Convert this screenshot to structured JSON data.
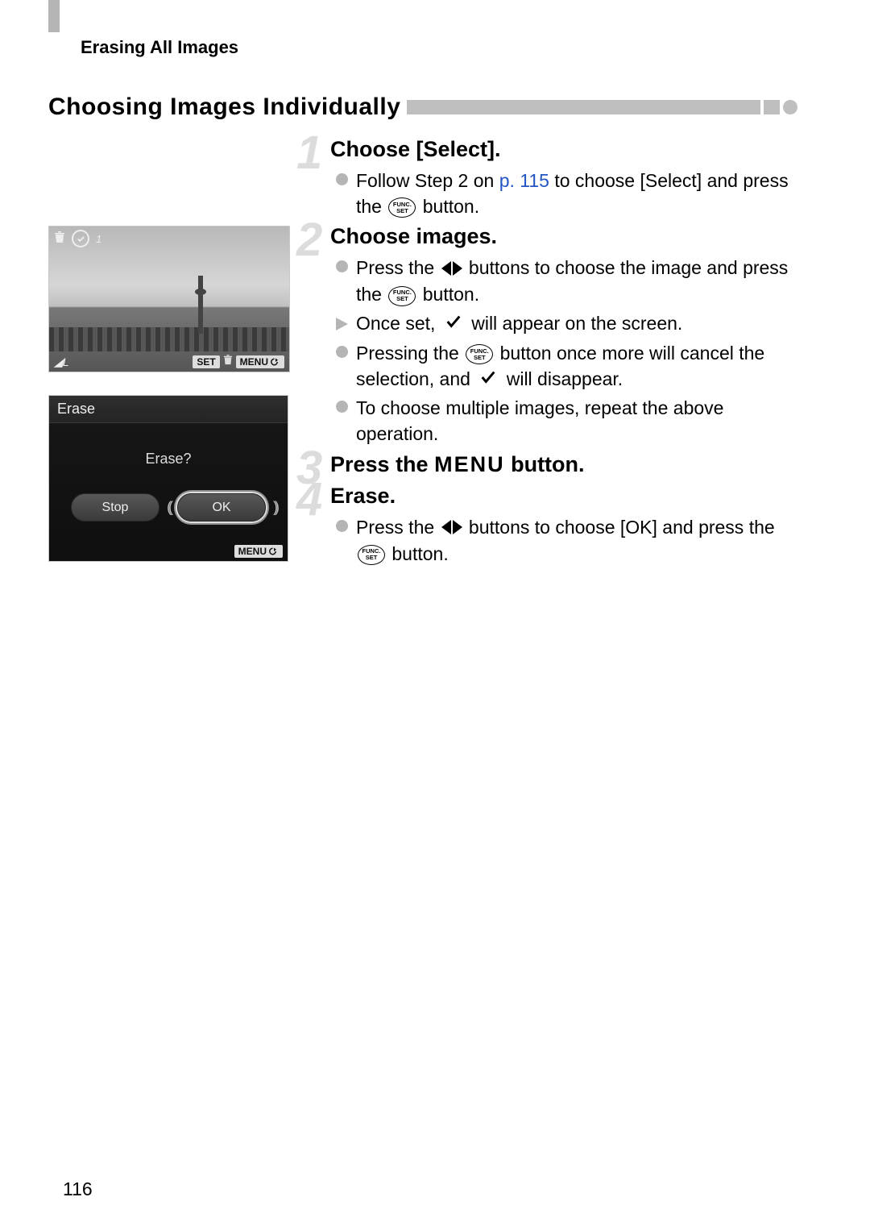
{
  "header": "Erasing All Images",
  "section_title": "Choosing Images Individually",
  "steps": {
    "s1": {
      "num": "1",
      "title": "Choose [Select].",
      "b1a": "Follow Step 2 on ",
      "b1_link": "p. 115",
      "b1b": " to choose [Select] and press the ",
      "b1c": " button."
    },
    "s2": {
      "num": "2",
      "title": "Choose images.",
      "b1a": "Press the ",
      "b1b": " buttons to choose the image and press the ",
      "b1c": " button.",
      "b2a": "Once set, ",
      "b2b": " will appear on the screen.",
      "b3a": "Pressing the ",
      "b3b": " button once more will cancel the selection, and ",
      "b3c": " will disappear.",
      "b4": "To choose multiple images, repeat the above operation."
    },
    "s3": {
      "num": "3",
      "title_a": "Press the ",
      "title_menu": "MENU",
      "title_b": " button."
    },
    "s4": {
      "num": "4",
      "title": "Erase.",
      "b1a": "Press the ",
      "b1b": " buttons to choose [OK] and press the ",
      "b1c": " button."
    }
  },
  "lcd_photo": {
    "count": "1",
    "corner_left": "L",
    "set_tag": "SET",
    "menu_tag": "MENU"
  },
  "lcd_erase": {
    "header": "Erase",
    "question": "Erase?",
    "stop_btn": "Stop",
    "ok_btn": "OK",
    "menu_tag": "MENU"
  },
  "funcset": {
    "top": "FUNC.",
    "bot": "SET"
  },
  "page_number": "116"
}
